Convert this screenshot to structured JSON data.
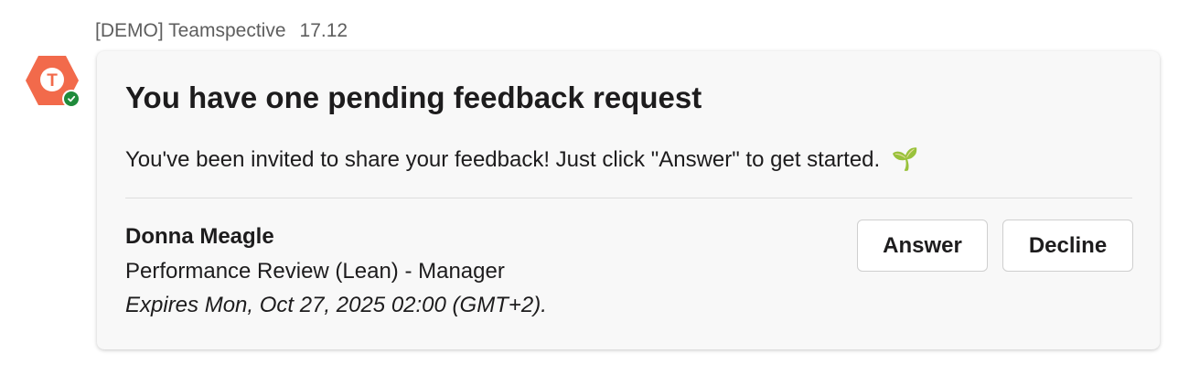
{
  "message": {
    "sender": "[DEMO] Teamspective",
    "time": "17.12",
    "avatar_letter": "T",
    "avatar_color": "#f26a4b",
    "presence_color": "#1f8b3b",
    "avatar_icon": "teamspective-logo-icon",
    "presence_icon": "checkmark-icon"
  },
  "card": {
    "title": "You have one pending feedback request",
    "description": "You've been invited to share your feedback! Just click \"Answer\" to get started.",
    "description_emoji": "🌱",
    "request": {
      "name": "Donna Meagle",
      "type": "Performance Review (Lean) - Manager",
      "expiry": "Expires Mon, Oct 27, 2025 02:00 (GMT+2)."
    },
    "buttons": {
      "answer_label": "Answer",
      "decline_label": "Decline"
    }
  }
}
